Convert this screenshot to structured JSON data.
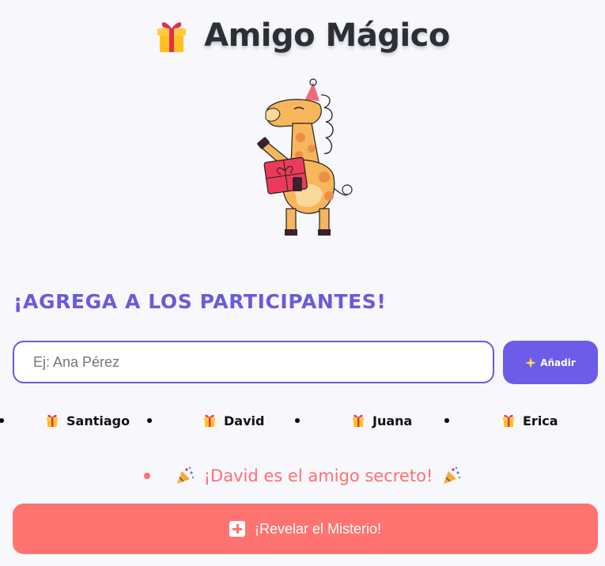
{
  "header": {
    "title": "Amigo Mágico",
    "icon": "gift-icon"
  },
  "section": {
    "title": "¡AGREGA A LOS PARTICIPANTES!"
  },
  "form": {
    "input_value": "",
    "input_placeholder": "Ej: Ana Pérez",
    "add_label": "Añadir",
    "add_icon": "sparkles-icon"
  },
  "participants": [
    {
      "name": "Santiago"
    },
    {
      "name": "David"
    },
    {
      "name": "Juana"
    },
    {
      "name": "Erica"
    }
  ],
  "result": {
    "text": "¡David es el amigo secreto!",
    "icon": "party-popper-icon"
  },
  "reveal": {
    "label": "¡Revelar el Misterio!",
    "icon": "plus-square-icon"
  },
  "colors": {
    "accent": "#6c5ce7",
    "result": "#ff6f6f",
    "reveal_button": "#ff7370",
    "title": "#2b2f36",
    "background": "#f7f7fc"
  }
}
